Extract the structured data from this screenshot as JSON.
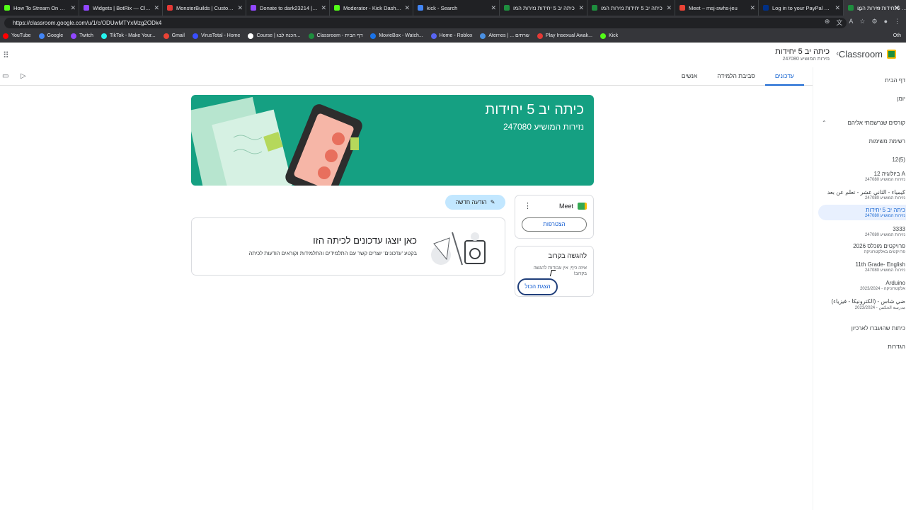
{
  "browser": {
    "tabs": [
      {
        "title": "How To Stream On Kick (For B",
        "color": "#53fc18"
      },
      {
        "title": "Widgets | BotRix — Cloud Str",
        "color": "#9147ff"
      },
      {
        "title": "MonsterBuilds | Custom Gam",
        "color": "#e53935"
      },
      {
        "title": "Donate to dark23214 | BotRi",
        "color": "#9147ff"
      },
      {
        "title": "Moderator - Kick Dashboard",
        "color": "#53fc18"
      },
      {
        "title": "kick - Search",
        "color": "#4285f4"
      },
      {
        "title": "כיתה יב 5 יחידות נזירות המו",
        "color": "#1e8e3e"
      },
      {
        "title": "כיתה יב 5 יחידות נזירות המו",
        "color": "#1e8e3e"
      },
      {
        "title": "Meet – msj-swhs-jeu",
        "color": "#ea4335"
      },
      {
        "title": "Log in to your PayPal account",
        "color": "#003087"
      },
      {
        "title": "כיתה יב 5 יחידות נזירות המו",
        "color": "#1e8e3e"
      }
    ],
    "new_tab": "+",
    "url": "https://classroom.google.com/u/1/c/ODUwMTYxMzg2ODk4",
    "bookmarks": [
      {
        "label": "YouTube",
        "color": "#ff0000"
      },
      {
        "label": "Google",
        "color": "#4285f4"
      },
      {
        "label": "Twitch",
        "color": "#9147ff"
      },
      {
        "label": "TikTok - Make Your...",
        "color": "#25f4ee"
      },
      {
        "label": "Gmail",
        "color": "#ea4335"
      },
      {
        "label": "VirusTotal - Home",
        "color": "#394eff"
      },
      {
        "label": "Course | הכנה לבג...",
        "color": "#ffffff"
      },
      {
        "label": "Classroom - דף הבית",
        "color": "#1e8e3e"
      },
      {
        "label": "MovieBox - Watch...",
        "color": "#1a73e8"
      },
      {
        "label": "Home - Roblox",
        "color": "#5865f2"
      },
      {
        "label": "Aternos | ... שרתים",
        "color": "#4a90e2"
      },
      {
        "label": "Play Insexual Awak...",
        "color": "#e53935"
      },
      {
        "label": "Kick",
        "color": "#53fc18"
      }
    ],
    "other_bookmarks": "Oth"
  },
  "app": {
    "name": "Classroom",
    "course_title": "כיתה יב 5 יחידות",
    "course_subtitle": "נזירות המושיע 247080",
    "tabs": [
      "עדכונים",
      "סביבת הלמידה",
      "אנשים"
    ],
    "active_tab": 0
  },
  "sidebar": {
    "items": [
      {
        "label": "דף הבית",
        "sub": ""
      },
      {
        "label": "יומן",
        "sub": ""
      },
      {
        "label": "קורסים שנרשמתי אליהם",
        "sub": ""
      },
      {
        "label": "רשימת משימות",
        "sub": ""
      },
      {
        "label": "12(5)",
        "sub": ""
      },
      {
        "label": "ביולוגיה 12 A",
        "sub": "נזירות המושיע 247080"
      },
      {
        "label": "كيمياء - الثاني عشر - تعلم عن بعد",
        "sub": "נזירות המושיע 247080"
      },
      {
        "label": "כיתה יב 5 יחידות",
        "sub": "נזירות המושיע 247080"
      },
      {
        "label": "3333",
        "sub": "נזירות המושיע 247080"
      },
      {
        "label": "פרויקטים מוכלס 2026",
        "sub": "פרויקטים באלקטרוניקה"
      },
      {
        "label": "11th Grade- English",
        "sub": "נזירות המושיע 247080"
      },
      {
        "label": "Arduino",
        "sub": "2023/2024 - אלקטרוניקה"
      },
      {
        "label": "ضي شاس - (الكترونيكا - فيزياء)",
        "sub": "2023/2024 - مدرسة الحكس"
      },
      {
        "label": "כיתות שהועברו לארכיון",
        "sub": ""
      },
      {
        "label": "הגדרות",
        "sub": ""
      }
    ],
    "active_index": 7
  },
  "banner": {
    "title": "כיתה יב 5 יחידות",
    "subtitle": "נזירות המושיע 247080",
    "color": "#15a082"
  },
  "stream": {
    "new_post_label": "הודעה חדשה",
    "empty_title": "כאן יוצגו עדכונים לכיתה הזו",
    "empty_text": "בקטע 'עדכונים' יוצרים קשר עם התלמידים והתלמידות וקוראים הודעות לכיתה"
  },
  "meet": {
    "label": "Meet",
    "join_label": "הצטרפות"
  },
  "upcoming": {
    "title": "להגשה בקרוב",
    "text": "איזה כיף, אין עבודות להגשה בקרוב!",
    "view_all_label": "הצגת הכול"
  },
  "colors": {
    "accent": "#1967d2",
    "active_bg": "#e8f0fe",
    "new_post_bg": "#c2e7ff"
  }
}
